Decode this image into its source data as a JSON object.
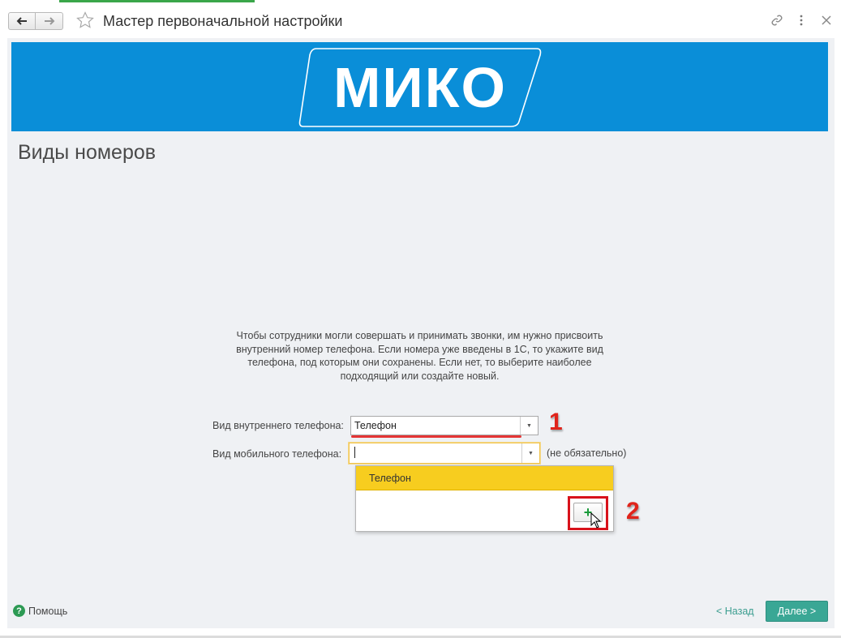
{
  "window": {
    "title": "Мастер первоначальной настройки",
    "back_icon": "arrow-left-icon",
    "forward_icon": "arrow-right-icon",
    "favorite_icon": "star-icon",
    "link_icon": "link-icon",
    "more_icon": "more-vertical-icon",
    "close_icon": "close-icon"
  },
  "banner": {
    "logo_text": "МИКО",
    "background_color": "#0a8ed8"
  },
  "page": {
    "title": "Виды номеров",
    "description": "Чтобы сотрудники могли совершать и принимать звонки, им нужно присвоить внутренний номер телефона. Если номера уже введены в 1С, то укажите вид телефона, под которым они сохранены. Если нет, то выберите наиболее подходящий или создайте новый."
  },
  "form": {
    "internal_label": "Вид внутреннего телефона:",
    "internal_value": "Телефон",
    "mobile_label": "Вид мобильного телефона:",
    "mobile_value": "",
    "optional_note": "(не обязательно)"
  },
  "dropdown": {
    "items": [
      "Телефон"
    ],
    "add_button": "+"
  },
  "annotations": {
    "marker_1": "1",
    "marker_2": "2",
    "color": "#e0241b"
  },
  "footer": {
    "help_label": "Помощь",
    "back_label": "< Назад",
    "next_label": "Далее >",
    "accent_color": "#3aa795"
  }
}
